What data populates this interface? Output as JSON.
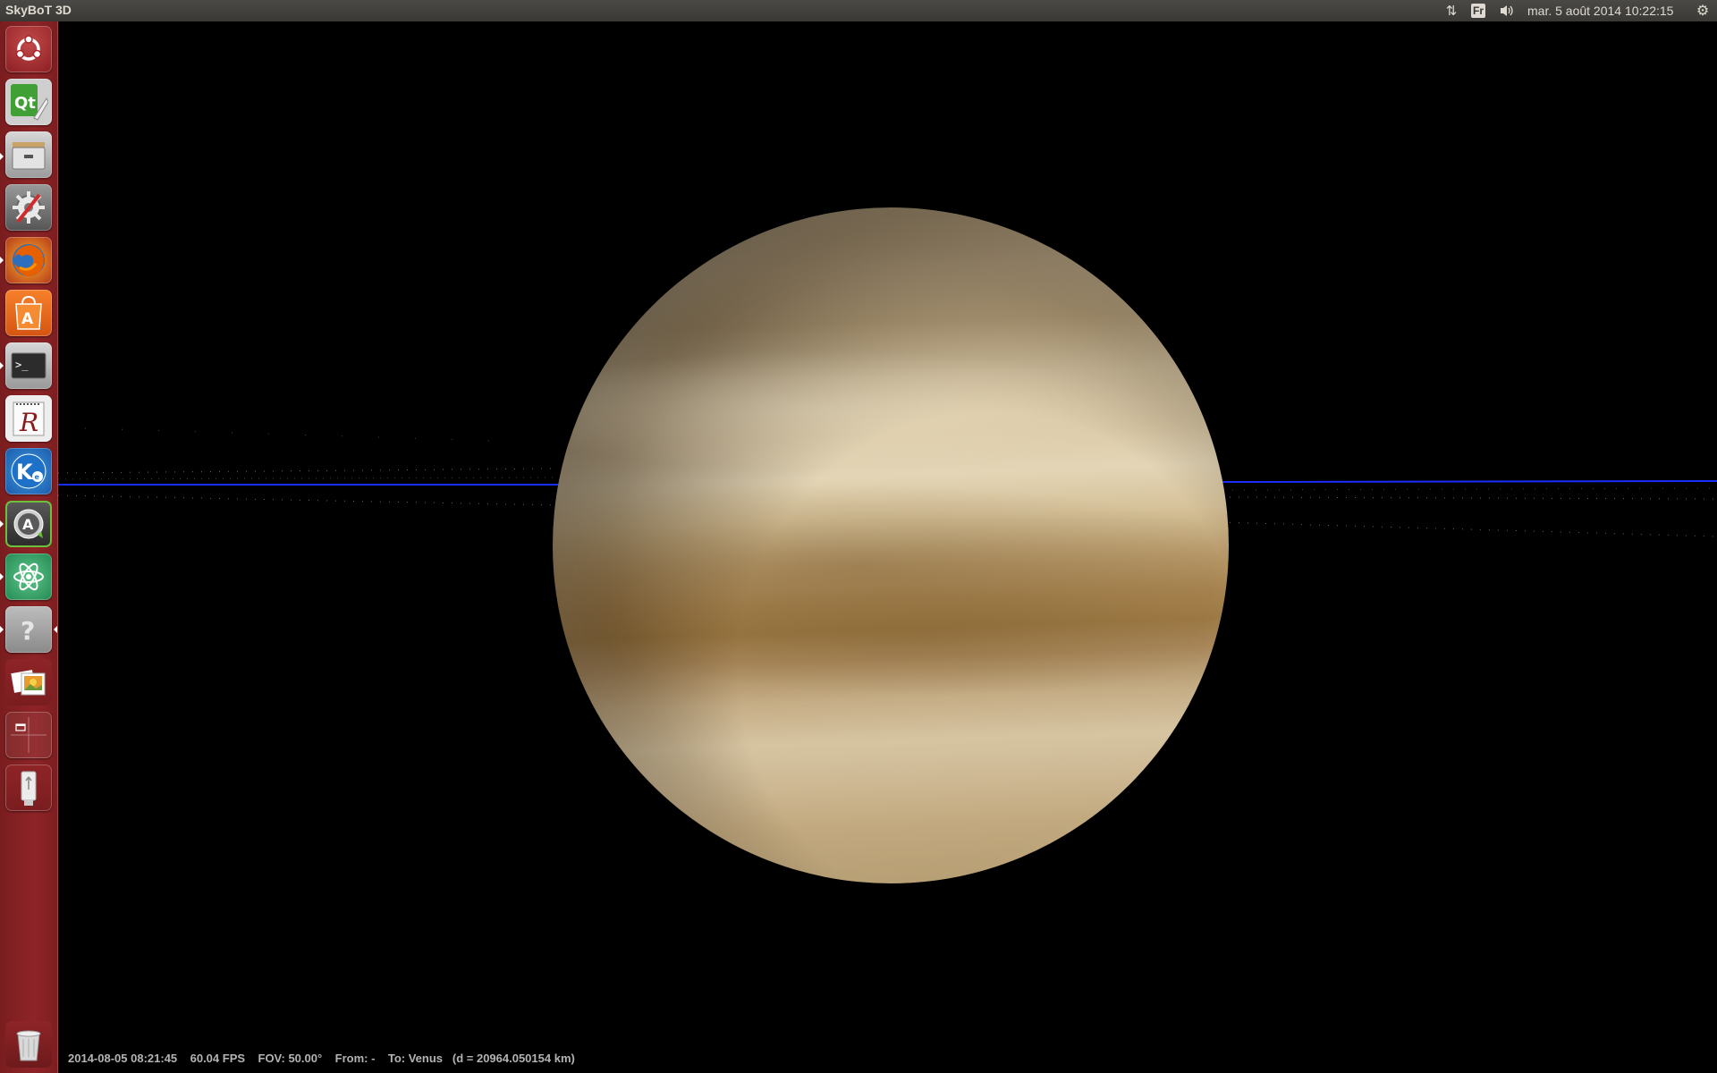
{
  "top_panel": {
    "app_title": "SkyBoT 3D",
    "keyboard_layout": "Fr",
    "clock": "mar. 5 août 2014 10:22:15"
  },
  "launcher": {
    "items": [
      {
        "name": "ubuntu-dash-icon"
      },
      {
        "name": "qt-creator-icon",
        "glyph": "Qt"
      },
      {
        "name": "file-manager-icon"
      },
      {
        "name": "system-settings-icon"
      },
      {
        "name": "firefox-icon"
      },
      {
        "name": "software-center-icon",
        "glyph": "A"
      },
      {
        "name": "terminal-icon",
        "glyph": ">_"
      },
      {
        "name": "rstudio-icon",
        "glyph": "R"
      },
      {
        "name": "kile-icon",
        "glyph": "K"
      },
      {
        "name": "software-updater-icon",
        "glyph": "A"
      },
      {
        "name": "atom-icon"
      },
      {
        "name": "help-icon",
        "glyph": "?"
      },
      {
        "name": "image-viewer-icon"
      },
      {
        "name": "workspace-switcher-icon"
      },
      {
        "name": "usb-drive-icon"
      },
      {
        "name": "trash-icon"
      }
    ]
  },
  "viewport": {
    "target_body": "Venus",
    "status": {
      "datetime": "2014-08-05 08:21:45",
      "fps": "60.04 FPS",
      "fov": "FOV: 50.00°",
      "from": "From: -",
      "to": "To: Venus",
      "distance": "(d = 20964.050154 km)"
    },
    "colors": {
      "orbit_line": "#1a2cff",
      "launcher_bg": "#8e2427",
      "panel_bg": "#3f3e3a"
    }
  }
}
